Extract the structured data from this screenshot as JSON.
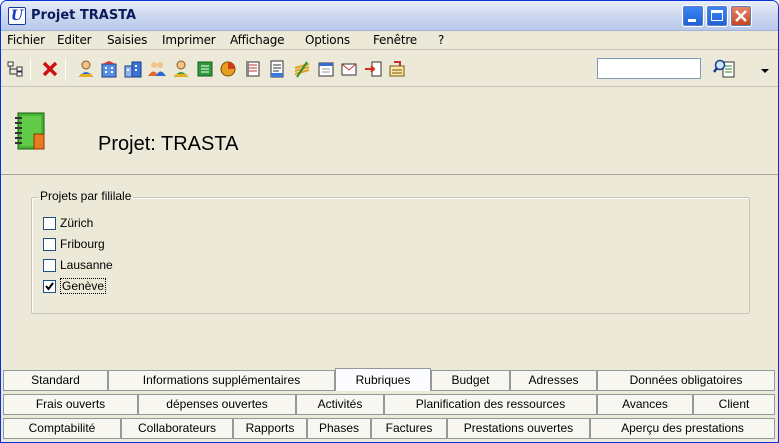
{
  "window": {
    "title": "Projet TRASTA",
    "app_icon": "U"
  },
  "menu": [
    {
      "label": "Fichier"
    },
    {
      "label": "Editer"
    },
    {
      "label": "Saisies"
    },
    {
      "label": "Imprimer"
    },
    {
      "label": "Affichage"
    },
    {
      "label": "Options"
    },
    {
      "label": "Fenêtre"
    },
    {
      "label": "?"
    }
  ],
  "toolbar": {
    "icons": [
      "tree-icon",
      "delete-icon",
      "person-icon",
      "building-icon",
      "buildings-icon",
      "people-icon",
      "user-icon",
      "ledger-icon",
      "chart-icon",
      "document-icon",
      "report-icon",
      "stack-icon",
      "calendar-icon",
      "mail-icon",
      "export-icon",
      "transfer-icon"
    ],
    "search_value": "",
    "search_icon": "find-document-icon"
  },
  "header": {
    "title": "Projet: TRASTA",
    "icon": "notebook-icon"
  },
  "group": {
    "legend": "Projets par fililale",
    "items": [
      {
        "label": "Zürich",
        "checked": false
      },
      {
        "label": "Fribourg",
        "checked": false
      },
      {
        "label": "Lausanne",
        "checked": false
      },
      {
        "label": "Genève",
        "checked": true
      }
    ]
  },
  "tabs": {
    "row1": [
      "Standard",
      "Informations supplémentaires",
      "Rubriques",
      "Budget",
      "Adresses",
      "Données obligatoires"
    ],
    "row2": [
      "Frais ouverts",
      "dépenses ouvertes",
      "Activités",
      "Planification des ressources",
      "Avances",
      "Client"
    ],
    "row3": [
      "Comptabilité",
      "Collaborateurs",
      "Rapports",
      "Phases",
      "Factures",
      "Prestations ouvertes",
      "Aperçu des prestations"
    ],
    "active": "Rubriques"
  },
  "colors": {
    "title_bar": "#cfdaf0",
    "face": "#ece9d8",
    "close_button": "#c3421b"
  }
}
